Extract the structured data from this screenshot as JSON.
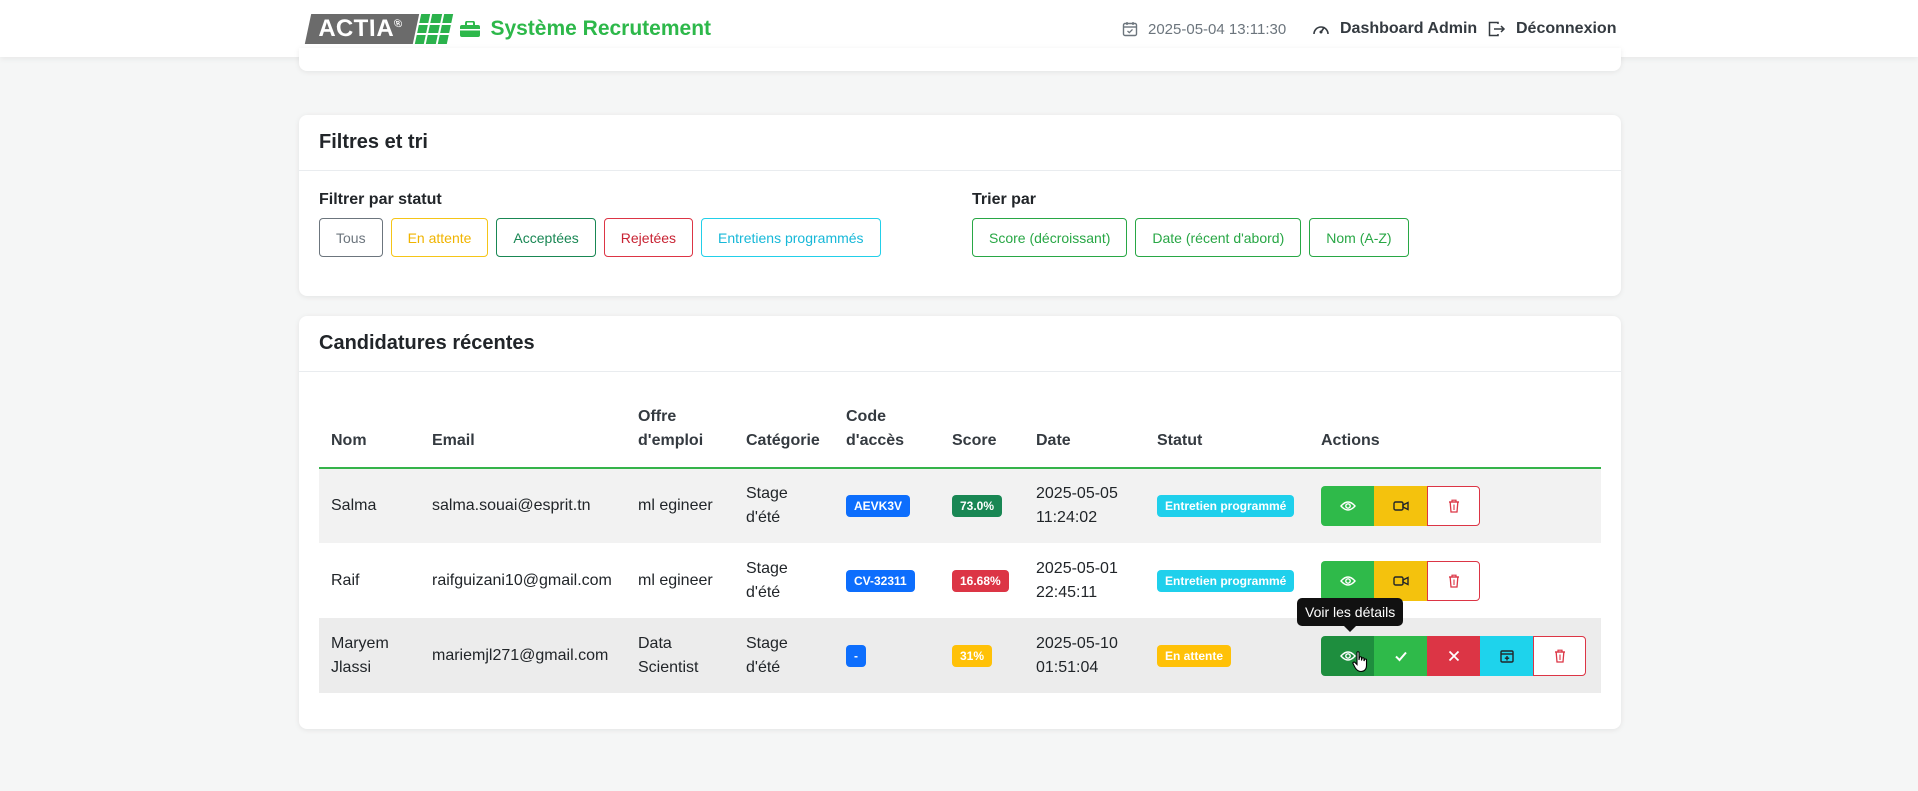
{
  "navbar": {
    "logo_text": "ACTIA",
    "logo_reg": "®",
    "brand": "Système Recrutement",
    "datetime": "2025-05-04 13:11:30",
    "dashboard": "Dashboard Admin",
    "logout": "Déconnexion",
    "brand_color": "#2db84a"
  },
  "filters": {
    "title": "Filtres et tri",
    "status_label": "Filtrer par statut",
    "status_buttons": [
      "Tous",
      "En attente",
      "Acceptées",
      "Rejetées",
      "Entretiens programmés"
    ],
    "sort_label": "Trier par",
    "sort_buttons": [
      "Score (décroissant)",
      "Date (récent d'abord)",
      "Nom (A-Z)"
    ]
  },
  "applications": {
    "title": "Candidatures récentes",
    "headers": {
      "nom": "Nom",
      "email": "Email",
      "offre_1": "Offre",
      "offre_2": "d'emploi",
      "categorie": "Catégorie",
      "code_1": "Code",
      "code_2": "d'accès",
      "score": "Score",
      "date": "Date",
      "statut": "Statut",
      "actions": "Actions"
    },
    "rows": [
      {
        "nom": "Salma",
        "email": "salma.souai@esprit.tn",
        "offre": "ml egineer",
        "categorie_1": "Stage",
        "categorie_2": "d'été",
        "code": "AEVK3V",
        "score": "73.0%",
        "date_1": "2025-05-05",
        "date_2": "11:24:02",
        "statut": "Entretien programmé"
      },
      {
        "nom": "Raif",
        "email": "raifguizani10@gmail.com",
        "offre": "ml egineer",
        "categorie_1": "Stage",
        "categorie_2": "d'été",
        "code": "CV-32311",
        "score": "16.68%",
        "date_1": "2025-05-01",
        "date_2": "22:45:11",
        "statut": "Entretien programmé"
      },
      {
        "nom_1": "Maryem",
        "nom_2": "Jlassi",
        "email": "mariemjl271@gmail.com",
        "offre_1": "Data",
        "offre_2": "Scientist",
        "categorie_1": "Stage",
        "categorie_2": "d'été",
        "code": "-",
        "score": "31%",
        "date_1": "2025-05-10",
        "date_2": "01:51:04",
        "statut": "En attente"
      }
    ],
    "tooltip": "Voir les détails"
  }
}
